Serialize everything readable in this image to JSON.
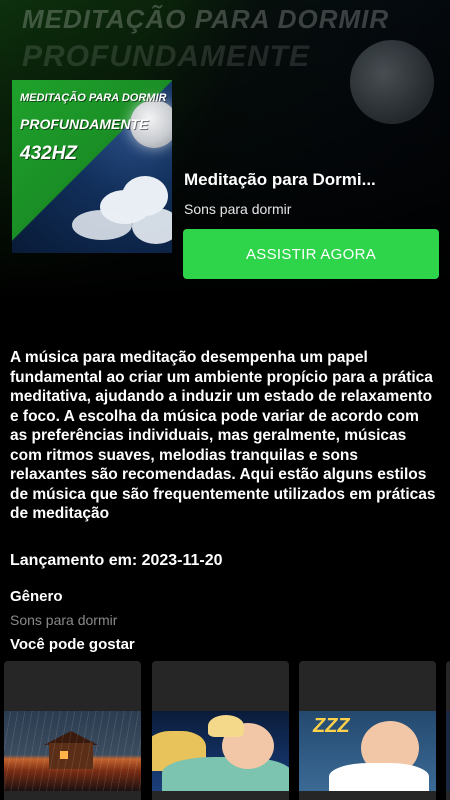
{
  "hero": {
    "background_line_1": "MEDITAÇÃO PARA DORMIR",
    "background_line_2": "PROFUNDAMENTE"
  },
  "poster": {
    "line_1": "MEDITAÇÃO PARA DORMIR",
    "line_2": "PROFUNDAMENTE",
    "line_3": "432HZ"
  },
  "details": {
    "title": "Meditação para Dormi...",
    "subtitle": "Sons para dormir",
    "watch_button_label": "ASSISTIR AGORA",
    "accent_color": "#2ed54a"
  },
  "description": "A música para meditação desempenha um papel fundamental ao criar um ambiente propício para a prática meditativa, ajudando a induzir um estado de relaxamento e foco. A escolha da música pode variar de acordo com as preferências individuais, mas geralmente, músicas com ritmos suaves, melodias tranquilas e sons relaxantes são recomendadas. Aqui estão alguns estilos de música que são frequentemente utilizados em práticas de meditação",
  "release": "Lançamento em: 2023-11-20",
  "genre": {
    "heading": "Gênero",
    "value": "Sons para dormir"
  },
  "recommendations": {
    "heading": "Você pode gostar",
    "cards": [
      {
        "image": "rainy-cabin-thumbnail"
      },
      {
        "image": "sleeping-baby-thumbnail"
      },
      {
        "image": "sleeping-baby-zzz-thumbnail",
        "caption": "ZZZ"
      },
      {
        "image": "partial-card-thumbnail"
      }
    ]
  }
}
